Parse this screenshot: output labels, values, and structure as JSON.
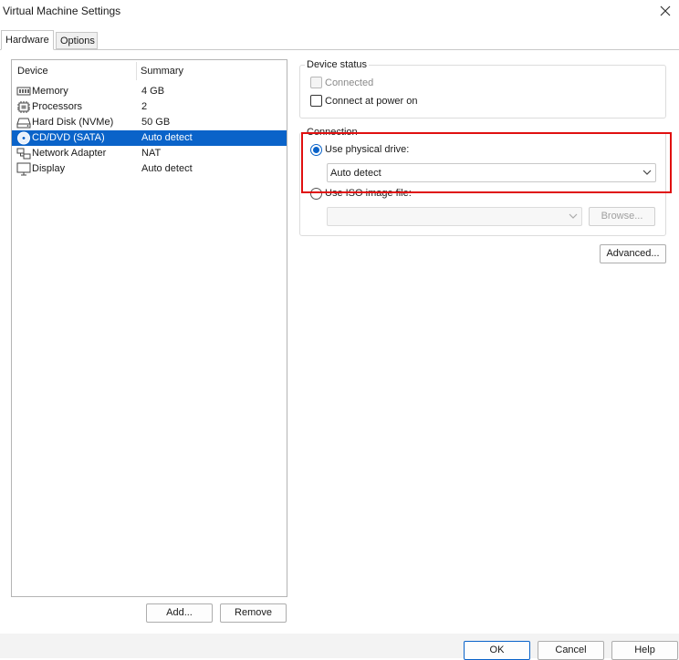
{
  "window": {
    "title": "Virtual Machine Settings",
    "close_icon": "close-icon"
  },
  "tabs": [
    {
      "label": "Hardware",
      "active": true
    },
    {
      "label": "Options",
      "active": false
    }
  ],
  "device_list": {
    "columns": [
      "Device",
      "Summary"
    ],
    "rows": [
      {
        "icon": "memory-icon",
        "device": "Memory",
        "summary": "4 GB"
      },
      {
        "icon": "processor-icon",
        "device": "Processors",
        "summary": "2"
      },
      {
        "icon": "hard-disk-icon",
        "device": "Hard Disk (NVMe)",
        "summary": "50 GB"
      },
      {
        "icon": "cd-dvd-icon",
        "device": "CD/DVD (SATA)",
        "summary": "Auto detect",
        "selected": true
      },
      {
        "icon": "network-adapter-icon",
        "device": "Network Adapter",
        "summary": "NAT"
      },
      {
        "icon": "display-icon",
        "device": "Display",
        "summary": "Auto detect"
      }
    ]
  },
  "list_buttons": {
    "add": "Add...",
    "remove": "Remove"
  },
  "device_status": {
    "title": "Device status",
    "connected": {
      "label": "Connected",
      "checked": false,
      "disabled": true
    },
    "connect_at_power_on": {
      "label": "Connect at power on",
      "checked": false
    }
  },
  "connection": {
    "title": "Connection",
    "use_physical_drive": {
      "label": "Use physical drive:",
      "selected": true
    },
    "physical_drive_value": "Auto detect",
    "use_iso": {
      "label": "Use ISO image file:",
      "selected": false
    },
    "iso_value": "",
    "browse": "Browse..."
  },
  "advanced": "Advanced...",
  "footer": {
    "ok": "OK",
    "cancel": "Cancel",
    "help": "Help"
  },
  "colors": {
    "selection": "#0a63c9",
    "highlight_box": "#e01010"
  }
}
